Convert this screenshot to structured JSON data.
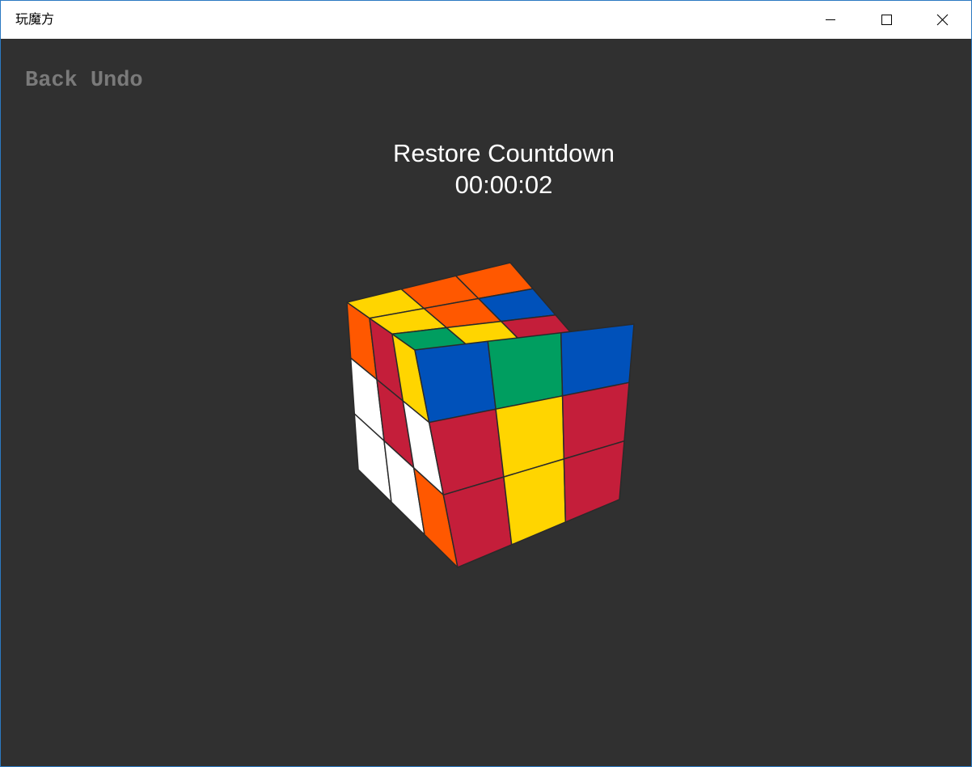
{
  "window": {
    "title": "玩魔方"
  },
  "nav": {
    "back_label": "Back",
    "undo_label": "Undo"
  },
  "countdown": {
    "label": "Restore Countdown",
    "time": "00:00:02"
  },
  "cube": {
    "size": 3,
    "colors": {
      "yellow": "#ffd500",
      "orange": "#ff5800",
      "blue": "#0051ba",
      "red": "#c41e3a",
      "green": "#009e60",
      "white": "#ffffff"
    },
    "faces": {
      "top": [
        [
          "yellow",
          "orange",
          "orange"
        ],
        [
          "yellow",
          "orange",
          "blue"
        ],
        [
          "green",
          "yellow",
          "red"
        ]
      ],
      "front": [
        [
          "blue",
          "green",
          "blue"
        ],
        [
          "red",
          "yellow",
          "red"
        ],
        [
          "red",
          "yellow",
          "red"
        ]
      ],
      "left": [
        [
          "orange",
          "red",
          "yellow"
        ],
        [
          "white",
          "red",
          "white"
        ],
        [
          "white",
          "white",
          "orange"
        ]
      ]
    }
  }
}
